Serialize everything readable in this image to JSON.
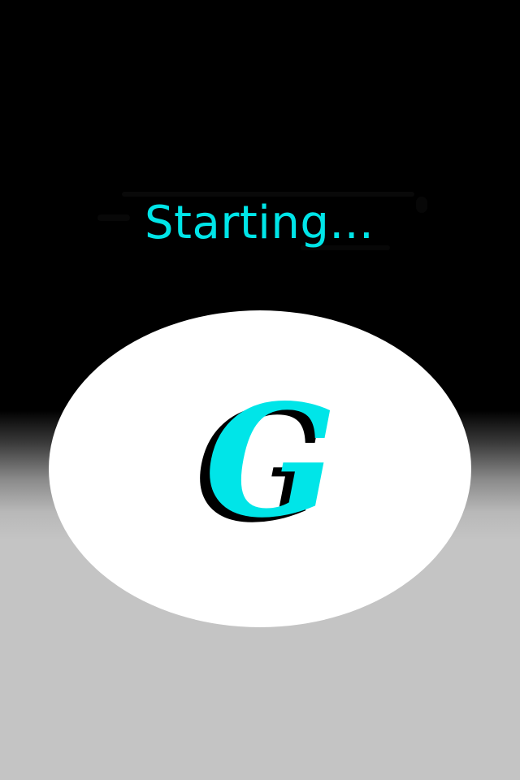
{
  "screen": {
    "status_text": "Starting..."
  },
  "logo": {
    "letter": "G",
    "icon": "g-logo-icon",
    "colors": {
      "letter": "#00e5e8",
      "shadow": "#000000",
      "badge": "#ffffff"
    }
  },
  "colors": {
    "background_top": "#000000",
    "background_bottom": "#c4c4c4",
    "status_text": "#00e5e8"
  }
}
